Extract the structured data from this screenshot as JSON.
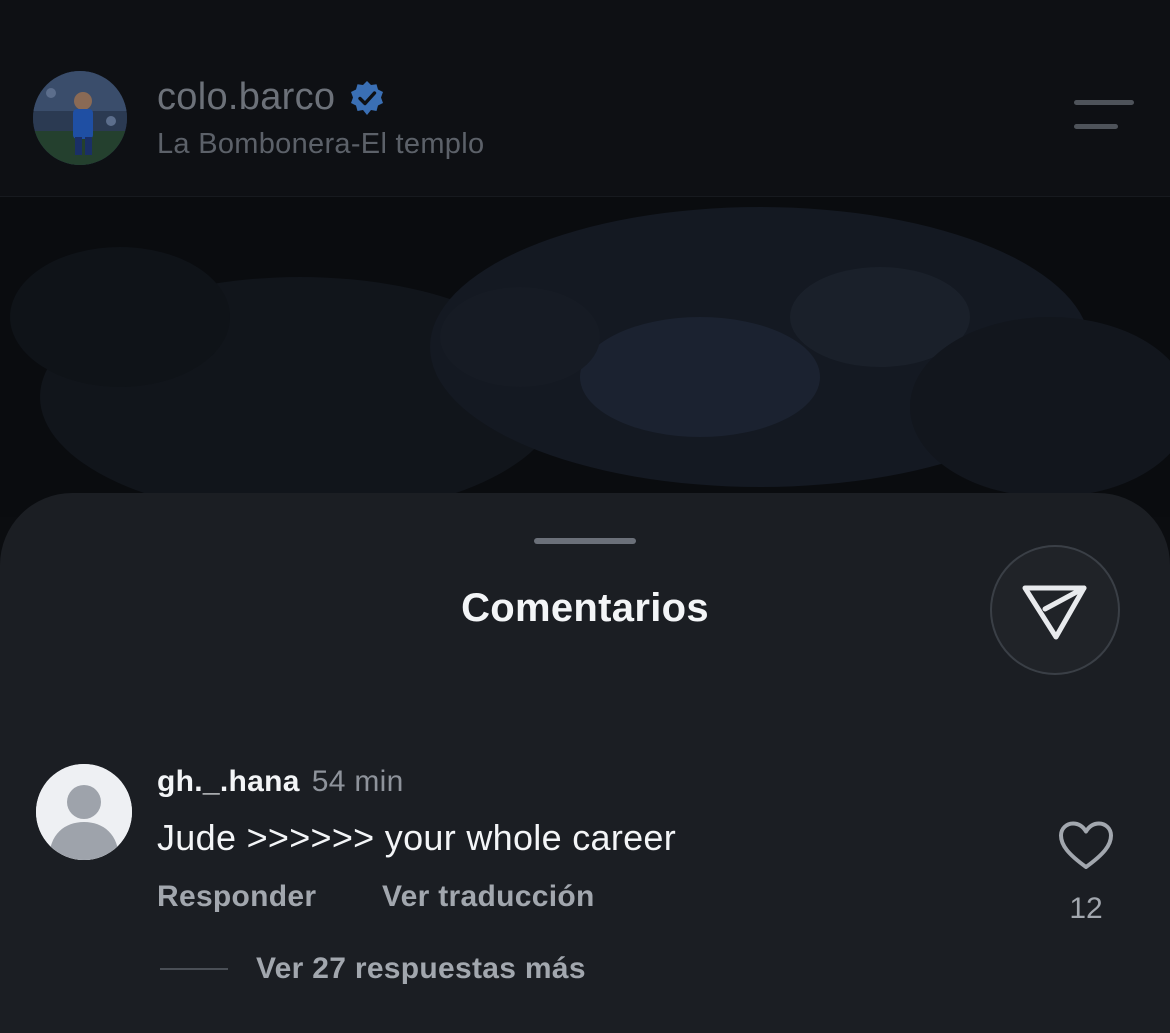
{
  "post": {
    "username": "colo.barco",
    "location": "La Bombonera-El templo",
    "verified": true,
    "icons": {
      "verified": "verified-badge-icon",
      "menu": "menu-icon"
    }
  },
  "comments_sheet": {
    "title": "Comentarios",
    "share_icon": "send-icon",
    "comments": [
      {
        "username": "gh._.hana",
        "time": "54 min",
        "text": "Jude >>>>>> your whole career",
        "reply_label": "Responder",
        "translate_label": "Ver traducción",
        "like_count": "12",
        "view_replies_label": "Ver 27 respuestas más"
      }
    ]
  },
  "colors": {
    "background": "#0b0d10",
    "sheet": "#1b1e23",
    "verified_badge": "#3a6fb4",
    "primary_text": "#f3f5f7",
    "secondary_text": "#a2a7ae"
  }
}
